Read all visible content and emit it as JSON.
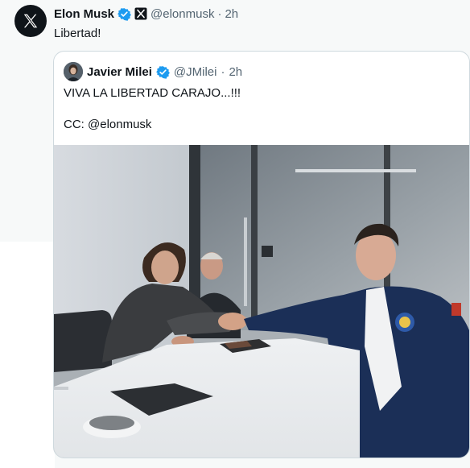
{
  "tweet": {
    "author_name": "Elon Musk",
    "verified_icon": "verified-badge-icon",
    "affiliate_icon": "x-affiliate-badge-icon",
    "handle": "@elonmusk",
    "separator": "·",
    "time": "2h",
    "text": "Libertad!"
  },
  "quote": {
    "author_name": "Javier Milei",
    "verified_icon": "verified-badge-icon",
    "handle": "@JMilei",
    "separator": "·",
    "time": "2h",
    "line1": "VIVA LA LIBERTAD CARAJO...!!!",
    "line2": "CC: @elonmusk",
    "media": "photo"
  },
  "colors": {
    "verified": "#1d9bf0",
    "text": "#0f1419",
    "secondary": "#536471",
    "border": "#cfd9de"
  }
}
